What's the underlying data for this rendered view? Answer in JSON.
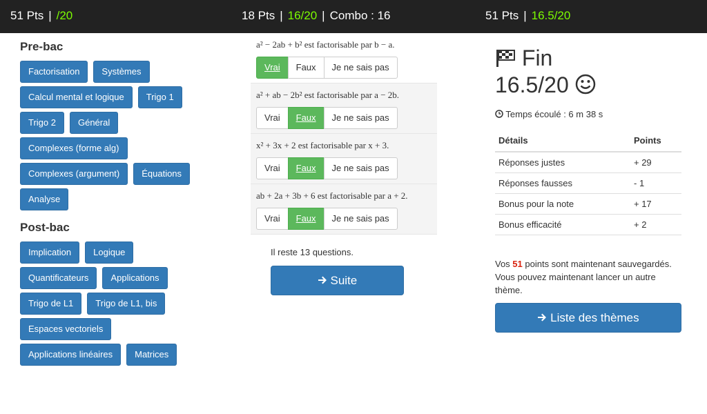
{
  "topbar": {
    "left": {
      "pts": "51 Pts",
      "score": "/20"
    },
    "middle": {
      "pts": "18 Pts",
      "score": "16/20",
      "combo": "Combo : 16"
    },
    "right": {
      "pts": "51 Pts",
      "score": "16.5/20"
    },
    "separator": "|"
  },
  "prebac": {
    "title": "Pre-bac",
    "themes": [
      "Factorisation",
      "Systèmes",
      "Calcul mental et logique",
      "Trigo 1",
      "Trigo 2",
      "Général",
      "Complexes (forme alg)",
      "Complexes (argument)",
      "Équations",
      "Analyse"
    ]
  },
  "postbac": {
    "title": "Post-bac",
    "themes": [
      "Implication",
      "Logique",
      "Quantificateurs",
      "Applications",
      "Trigo de L1",
      "Trigo de L1, bis",
      "Espaces vectoriels",
      "Applications linéaires",
      "Matrices"
    ]
  },
  "questions": [
    {
      "text": "a² − 2ab + b² est factorisable par b − a.",
      "options": [
        "Vrai",
        "Faux",
        "Je ne sais pas"
      ],
      "selected": "Vrai"
    },
    {
      "text": "a² + ab − 2b² est factorisable par a − 2b.",
      "options": [
        "Vrai",
        "Faux",
        "Je ne sais pas"
      ],
      "selected": "Faux"
    },
    {
      "text": "x² + 3x + 2 est factorisable par x + 3.",
      "options": [
        "Vrai",
        "Faux",
        "Je ne sais pas"
      ],
      "selected": "Faux"
    },
    {
      "text": "ab + 2a + 3b + 6 est factorisable par a + 2.",
      "options": [
        "Vrai",
        "Faux",
        "Je ne sais pas"
      ],
      "selected": "Faux"
    }
  ],
  "remaining": "Il reste 13 questions.",
  "suite_label": "Suite",
  "result": {
    "fin": "Fin",
    "score": "16.5/20",
    "elapsed": "Temps écoulé : 6 m 38 s",
    "headers": {
      "detail": "Détails",
      "points": "Points"
    },
    "rows": [
      {
        "label": "Réponses justes",
        "value": "+ 29"
      },
      {
        "label": "Réponses fausses",
        "value": "- 1"
      },
      {
        "label": "Bonus pour la note",
        "value": "+ 17"
      },
      {
        "label": "Bonus efficacité",
        "value": "+ 2"
      }
    ],
    "saved_prefix": "Vos ",
    "saved_points": "51",
    "saved_suffix": " points sont maintenant sauvegardés. Vous pouvez maintenant lancer un autre thème.",
    "list_button": "Liste des thèmes"
  },
  "colors": {
    "topbar_bg": "#222222",
    "green": "#7cfc00",
    "primary": "#337ab7",
    "success": "#5cb85c",
    "red": "#d9230f"
  },
  "icons": {
    "fin": "checkered-flag-icon",
    "smiley": "smiley-icon",
    "clock": "clock-icon",
    "arrow": "arrow-right-icon"
  }
}
